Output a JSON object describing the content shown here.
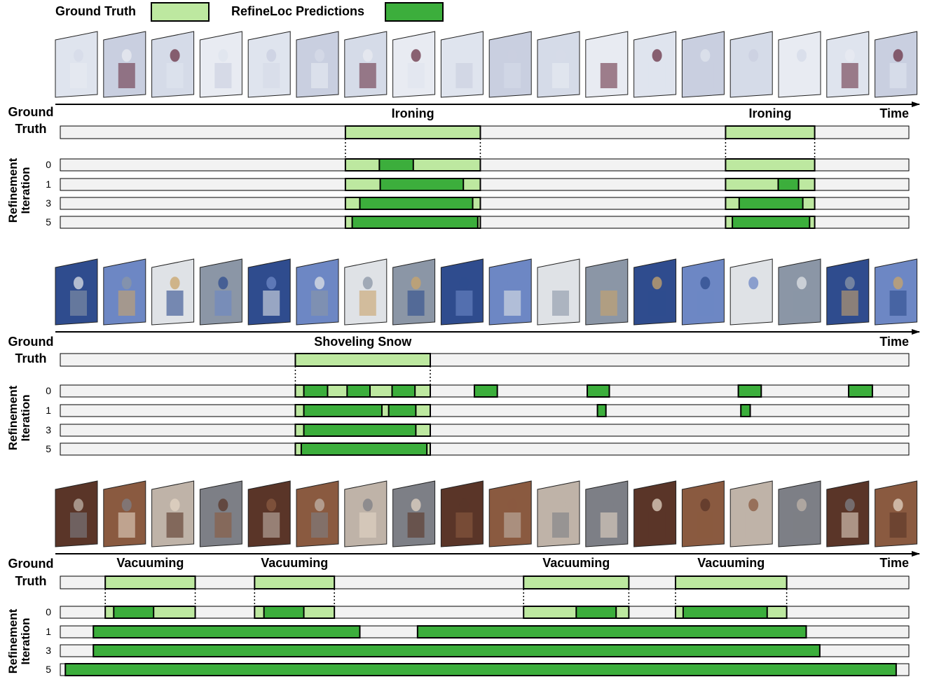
{
  "legend": {
    "ground_truth_label": "Ground Truth",
    "predictions_label": "RefineLoc Predictions",
    "gt_color": "#bde8a0",
    "pred_color": "#3cae3c",
    "track_color": "#f2f2f2"
  },
  "labels": {
    "ground_truth_row": [
      "Ground",
      "Truth"
    ],
    "refinement_axis": [
      "Refinement",
      "Iteration"
    ],
    "time": "Time"
  },
  "panels": [
    {
      "id": "ironing",
      "frame_tint": "cool-white",
      "ground_truth": [
        {
          "label": "Ironing",
          "start": 0.336,
          "end": 0.495
        },
        {
          "label": "Ironing",
          "start": 0.784,
          "end": 0.889
        }
      ],
      "iterations": [
        {
          "iteration": "0",
          "preds": [
            [
              0.376,
              0.416
            ]
          ]
        },
        {
          "iteration": "1",
          "preds": [
            [
              0.377,
              0.475
            ],
            [
              0.846,
              0.87
            ]
          ]
        },
        {
          "iteration": "3",
          "preds": [
            [
              0.353,
              0.486
            ],
            [
              0.8,
              0.875
            ]
          ]
        },
        {
          "iteration": "5",
          "preds": [
            [
              0.344,
              0.492
            ],
            [
              0.792,
              0.883
            ]
          ]
        }
      ]
    },
    {
      "id": "shoveling-snow",
      "frame_tint": "news-snow",
      "ground_truth": [
        {
          "label": "Shoveling Snow",
          "start": 0.277,
          "end": 0.436
        }
      ],
      "iterations": [
        {
          "iteration": "0",
          "preds": [
            [
              0.287,
              0.315
            ],
            [
              0.338,
              0.365
            ],
            [
              0.391,
              0.418
            ],
            [
              0.488,
              0.515
            ],
            [
              0.621,
              0.647
            ],
            [
              0.799,
              0.826
            ],
            [
              0.929,
              0.957
            ]
          ]
        },
        {
          "iteration": "1",
          "preds": [
            [
              0.287,
              0.379
            ],
            [
              0.387,
              0.419
            ],
            [
              0.633,
              0.643
            ],
            [
              0.802,
              0.813
            ]
          ]
        },
        {
          "iteration": "3",
          "preds": [
            [
              0.287,
              0.419
            ]
          ]
        },
        {
          "iteration": "5",
          "preds": [
            [
              0.284,
              0.432
            ]
          ]
        }
      ]
    },
    {
      "id": "vacuuming",
      "frame_tint": "warm-indoor",
      "ground_truth": [
        {
          "label": "Vacuuming",
          "start": 0.053,
          "end": 0.159
        },
        {
          "label": "Vacuuming",
          "start": 0.229,
          "end": 0.323
        },
        {
          "label": "Vacuuming",
          "start": 0.546,
          "end": 0.67
        },
        {
          "label": "Vacuuming",
          "start": 0.725,
          "end": 0.856
        }
      ],
      "iterations": [
        {
          "iteration": "0",
          "preds": [
            [
              0.063,
              0.11
            ],
            [
              0.24,
              0.287
            ],
            [
              0.608,
              0.655
            ],
            [
              0.734,
              0.833
            ]
          ]
        },
        {
          "iteration": "1",
          "preds": [
            [
              0.039,
              0.353
            ],
            [
              0.421,
              0.879
            ]
          ]
        },
        {
          "iteration": "3",
          "preds": [
            [
              0.039,
              0.895
            ]
          ]
        },
        {
          "iteration": "5",
          "preds": [
            [
              0.006,
              0.985
            ]
          ]
        }
      ]
    }
  ]
}
